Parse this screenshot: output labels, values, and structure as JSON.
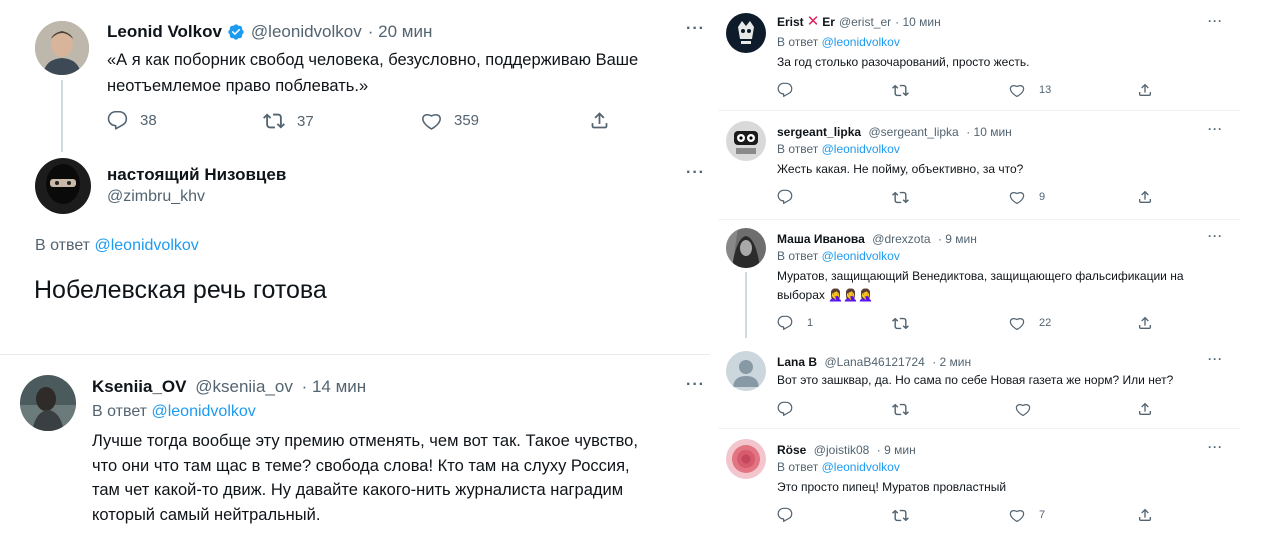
{
  "left": {
    "tweet1": {
      "name": "Leonid Volkov",
      "handle": "@leonidvolkov",
      "time": "· 20 мин",
      "text_line1": "«А я как поборник свобод человека, безусловно, поддерживаю Ваше",
      "text_line2": "неотъемлемое право поблевать.»",
      "replies": "38",
      "retweets": "37",
      "likes": "359"
    },
    "tweet2": {
      "name": "настоящий Низовцев",
      "handle": "@zimbru_khv",
      "reply_prefix": "В ответ",
      "reply_to": "@leonidvolkov",
      "text": "Нобелевская речь готова"
    },
    "tweet3": {
      "name": "Kseniia_OV",
      "handle": "@kseniia_ov",
      "time": "· 14 мин",
      "reply_prefix": "В ответ",
      "reply_to": "@leonidvolkov",
      "text_lines": [
        "Лучше тогда вообще эту премию отменять, чем вот так. Такое чувство,",
        "что они что там щас в теме?  свобода слова! Кто там на слуху Россия,",
        "там чет какой-то движ. Ну давайте какого-нить журналиста наградим",
        "который самый нейтральный."
      ]
    }
  },
  "right": {
    "replies": [
      {
        "name": "Erist",
        "name2": "Er",
        "handle": "@erist_er",
        "time": "· 10 мин",
        "reply_prefix": "В ответ",
        "reply_to": "@leonidvolkov",
        "text_lines": [
          "За год столько разочарований, просто жесть."
        ],
        "replies": "",
        "retweets": "",
        "likes": "13"
      },
      {
        "name": "sergeant_lipka",
        "handle": "@sergeant_lipka",
        "time": "· 10 мин",
        "reply_prefix": "В ответ",
        "reply_to": "@leonidvolkov",
        "text_lines": [
          "Жесть какая. Не пойму, объективно, за что?"
        ],
        "replies": "",
        "retweets": "",
        "likes": "9"
      },
      {
        "name": "Маша Иванова",
        "handle": "@drexzota",
        "time": "· 9 мин",
        "reply_prefix": "В ответ",
        "reply_to": "@leonidvolkov",
        "text_lines": [
          "Муратов, защищающий Венедиктова, защищающего фальсификации на",
          "выборах"
        ],
        "emoji": "🤦‍♀️🤦‍♀️🤦‍♀️",
        "replies": "1",
        "retweets": "",
        "likes": "22"
      },
      {
        "name": "Lana B",
        "handle": "@LanaB46121724",
        "time": "· 2 мин",
        "text_lines": [
          "Вот это зашквар, да. Но сама по себе Новая газета же норм? Или нет?"
        ],
        "replies": "",
        "retweets": "",
        "likes": ""
      },
      {
        "name": "Röse",
        "handle": "@joistik08",
        "time": "· 9 мин",
        "reply_prefix": "В ответ",
        "reply_to": "@leonidvolkov",
        "text_lines": [
          "Это просто пипец! Муратов провластный"
        ],
        "replies": "",
        "retweets": "",
        "likes": "7"
      }
    ]
  },
  "more_label": "···",
  "colors": {
    "accent": "#1d9bf0",
    "muted": "#536471",
    "text": "#0f1419",
    "divider": "#eff3f4",
    "verified": "#1d9bf0",
    "cross": "#e0245e"
  },
  "icons": [
    "reply-icon",
    "retweet-icon",
    "like-icon",
    "share-icon",
    "verified-badge-icon",
    "more-icon"
  ]
}
